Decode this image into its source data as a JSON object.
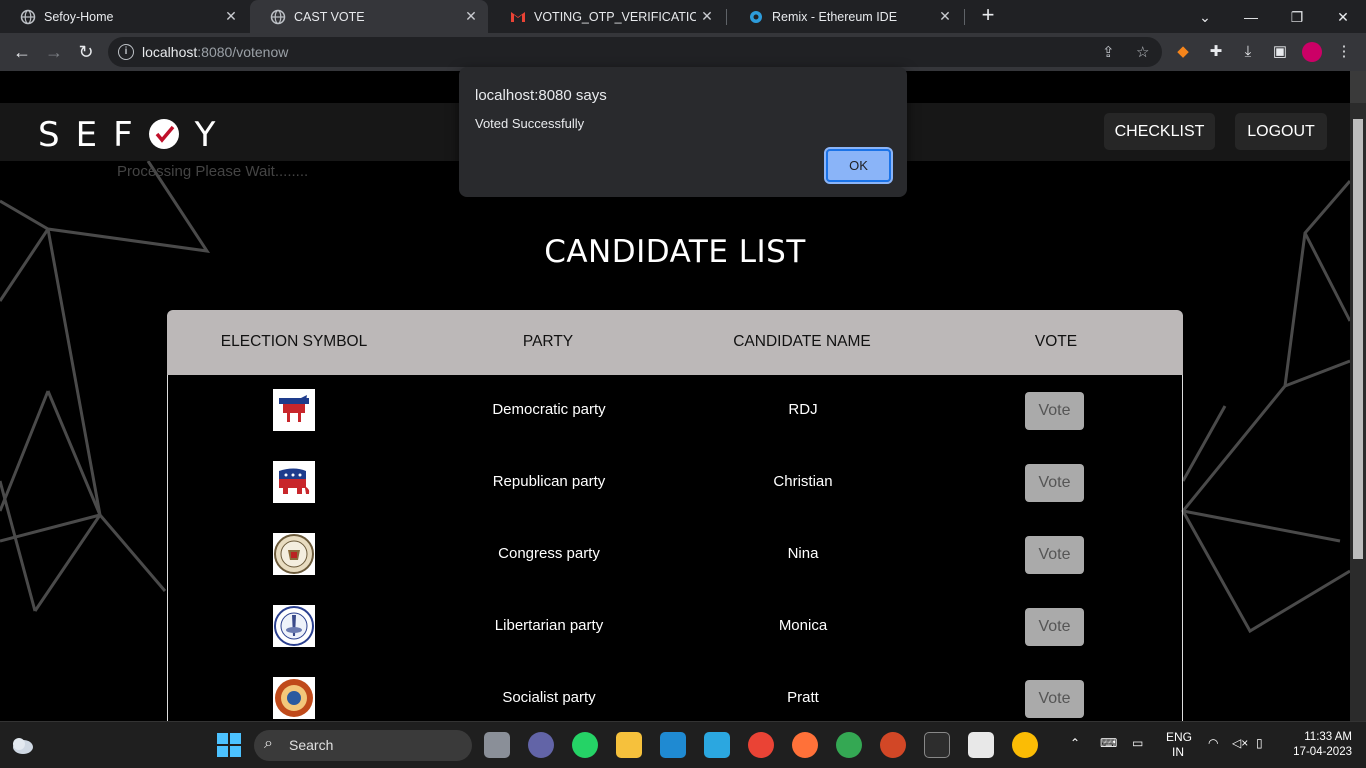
{
  "browser": {
    "tabs": [
      {
        "title": "Sefoy-Home"
      },
      {
        "title": "CAST VOTE"
      },
      {
        "title": "VOTING_OTP_VERIFICATION - sh"
      },
      {
        "title": "Remix - Ethereum IDE"
      }
    ],
    "url_host": "localhost",
    "url_rest": ":8080/votenow"
  },
  "site": {
    "logo_prefix": "SEF",
    "logo_suffix": "Y",
    "nav": {
      "checklist": "CHECKLIST",
      "logout": "LOGOUT"
    },
    "processing": "Processing Please Wait........",
    "heading": "CANDIDATE LIST"
  },
  "table": {
    "headers": [
      "ELECTION SYMBOL",
      "PARTY",
      "CANDIDATE NAME",
      "VOTE"
    ],
    "rows": [
      {
        "symbol": "donkey-icon",
        "party": "Democratic party",
        "candidate": "RDJ",
        "vote": "Vote"
      },
      {
        "symbol": "elephant-icon",
        "party": "Republican party",
        "candidate": "Christian",
        "vote": "Vote"
      },
      {
        "symbol": "seal-icon",
        "party": "Congress party",
        "candidate": "Nina",
        "vote": "Vote"
      },
      {
        "symbol": "seal-icon",
        "party": "Libertarian party",
        "candidate": "Monica",
        "vote": "Vote"
      },
      {
        "symbol": "seal-icon",
        "party": "Socialist party",
        "candidate": "Pratt",
        "vote": "Vote"
      }
    ]
  },
  "dialog": {
    "title": "localhost:8080 says",
    "message": "Voted Successfully",
    "ok": "OK"
  },
  "taskbar": {
    "search": "Search",
    "lang1": "ENG",
    "lang2": "IN",
    "time": "11:33 AM",
    "date": "17-04-2023"
  }
}
